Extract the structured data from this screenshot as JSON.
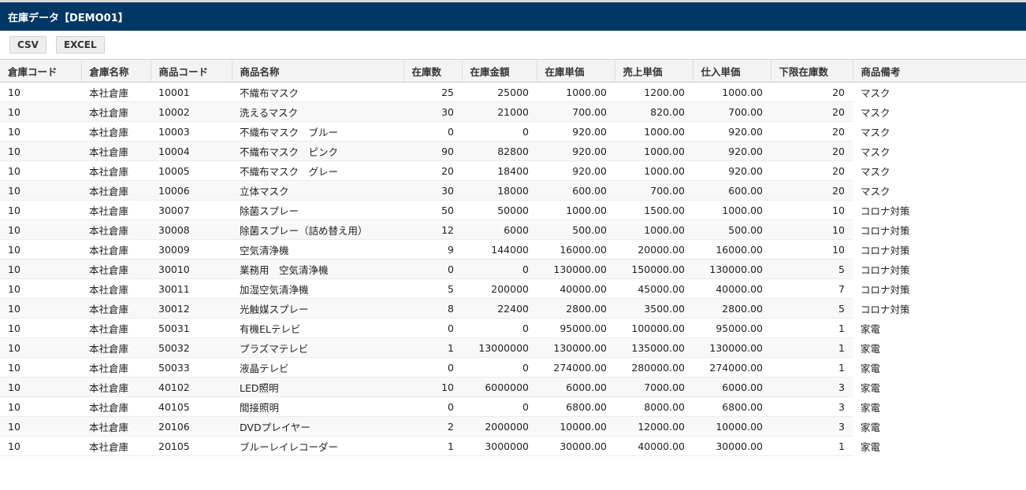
{
  "window": {
    "title": "在庫データ【DEMO01】"
  },
  "toolbar": {
    "csv_label": "CSV",
    "excel_label": "EXCEL"
  },
  "table": {
    "headers": [
      "倉庫コード",
      "倉庫名称",
      "商品コード",
      "商品名称",
      "在庫数",
      "在庫金額",
      "在庫単価",
      "売上単価",
      "仕入単価",
      "下限在庫数",
      "商品備考"
    ],
    "rows": [
      [
        "10",
        "本社倉庫",
        "10001",
        "不織布マスク",
        "25",
        "25000",
        "1000.00",
        "1200.00",
        "1000.00",
        "20",
        "マスク"
      ],
      [
        "10",
        "本社倉庫",
        "10002",
        "洗えるマスク",
        "30",
        "21000",
        "700.00",
        "820.00",
        "700.00",
        "20",
        "マスク"
      ],
      [
        "10",
        "本社倉庫",
        "10003",
        "不織布マスク　ブルー",
        "0",
        "0",
        "920.00",
        "1000.00",
        "920.00",
        "20",
        "マスク"
      ],
      [
        "10",
        "本社倉庫",
        "10004",
        "不織布マスク　ピンク",
        "90",
        "82800",
        "920.00",
        "1000.00",
        "920.00",
        "20",
        "マスク"
      ],
      [
        "10",
        "本社倉庫",
        "10005",
        "不織布マスク　グレー",
        "20",
        "18400",
        "920.00",
        "1000.00",
        "920.00",
        "20",
        "マスク"
      ],
      [
        "10",
        "本社倉庫",
        "10006",
        "立体マスク",
        "30",
        "18000",
        "600.00",
        "700.00",
        "600.00",
        "20",
        "マスク"
      ],
      [
        "10",
        "本社倉庫",
        "30007",
        "除菌スプレー",
        "50",
        "50000",
        "1000.00",
        "1500.00",
        "1000.00",
        "10",
        "コロナ対策"
      ],
      [
        "10",
        "本社倉庫",
        "30008",
        "除菌スプレー（詰め替え用）",
        "12",
        "6000",
        "500.00",
        "1000.00",
        "500.00",
        "10",
        "コロナ対策"
      ],
      [
        "10",
        "本社倉庫",
        "30009",
        "空気清浄機",
        "9",
        "144000",
        "16000.00",
        "20000.00",
        "16000.00",
        "10",
        "コロナ対策"
      ],
      [
        "10",
        "本社倉庫",
        "30010",
        "業務用　空気清浄機",
        "0",
        "0",
        "130000.00",
        "150000.00",
        "130000.00",
        "5",
        "コロナ対策"
      ],
      [
        "10",
        "本社倉庫",
        "30011",
        "加湿空気清浄機",
        "5",
        "200000",
        "40000.00",
        "45000.00",
        "40000.00",
        "7",
        "コロナ対策"
      ],
      [
        "10",
        "本社倉庫",
        "30012",
        "光触媒スプレー",
        "8",
        "22400",
        "2800.00",
        "3500.00",
        "2800.00",
        "5",
        "コロナ対策"
      ],
      [
        "10",
        "本社倉庫",
        "50031",
        "有機ELテレビ",
        "0",
        "0",
        "95000.00",
        "100000.00",
        "95000.00",
        "1",
        "家電"
      ],
      [
        "10",
        "本社倉庫",
        "50032",
        "プラズマテレビ",
        "1",
        "13000000",
        "130000.00",
        "135000.00",
        "130000.00",
        "1",
        "家電"
      ],
      [
        "10",
        "本社倉庫",
        "50033",
        "液晶テレビ",
        "0",
        "0",
        "274000.00",
        "280000.00",
        "274000.00",
        "1",
        "家電"
      ],
      [
        "10",
        "本社倉庫",
        "40102",
        "LED照明",
        "10",
        "6000000",
        "6000.00",
        "7000.00",
        "6000.00",
        "3",
        "家電"
      ],
      [
        "10",
        "本社倉庫",
        "40105",
        "間接照明",
        "0",
        "0",
        "6800.00",
        "8000.00",
        "6800.00",
        "3",
        "家電"
      ],
      [
        "10",
        "本社倉庫",
        "20106",
        "DVDプレイヤー",
        "2",
        "2000000",
        "10000.00",
        "12000.00",
        "10000.00",
        "3",
        "家電"
      ],
      [
        "10",
        "本社倉庫",
        "20105",
        "ブルーレイレコーダー",
        "1",
        "3000000",
        "30000.00",
        "40000.00",
        "30000.00",
        "1",
        "家電"
      ]
    ]
  }
}
